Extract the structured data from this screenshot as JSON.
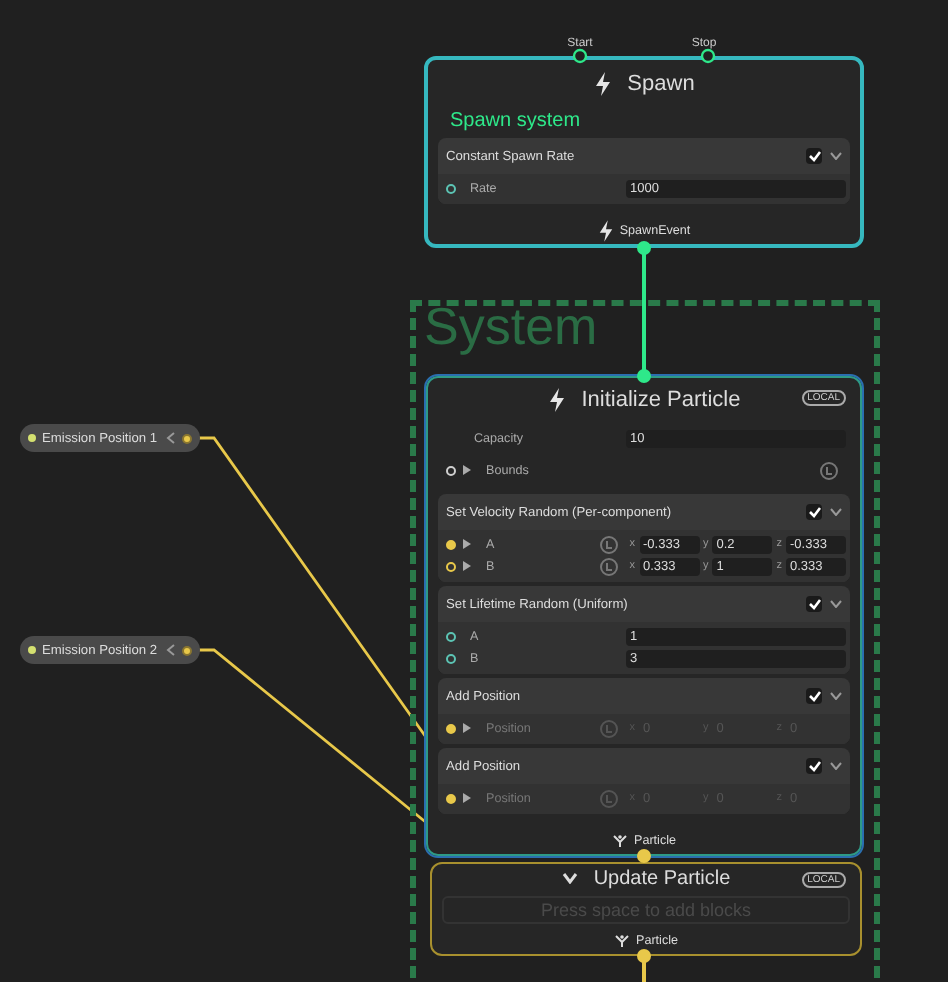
{
  "system": {
    "title": "System"
  },
  "parameters": [
    {
      "label": "Emission Position 1"
    },
    {
      "label": "Emission Position 2"
    }
  ],
  "contexts": [
    {
      "kind": "spawn",
      "title": "Spawn",
      "inputs": [
        "Start",
        "Stop"
      ],
      "subtitle": "Spawn system",
      "blocks": [
        {
          "title": "Constant Spawn Rate",
          "enabled": true,
          "rows": [
            {
              "kind": "field",
              "label": "Rate",
              "value": "1000",
              "port": {
                "color": "#5cc4b4",
                "connected": false
              }
            }
          ]
        }
      ],
      "output": "SpawnEvent"
    },
    {
      "kind": "initialize",
      "title": "Initialize Particle",
      "badge": "LOCAL",
      "rows": [
        {
          "kind": "field",
          "label": "Capacity",
          "value": "10"
        },
        {
          "kind": "space",
          "label": "Bounds",
          "expandable": true,
          "port": {
            "color": "#cfcfcf",
            "connected": false
          }
        }
      ],
      "blocks": [
        {
          "title": "Set Velocity Random (Per-component)",
          "enabled": true,
          "rows": [
            {
              "kind": "vector",
              "label": "A",
              "expandable": true,
              "port": {
                "color": "#e8c84a",
                "connected": true
              },
              "components": [
                {
                  "axis": "x",
                  "value": "-0.333"
                },
                {
                  "axis": "y",
                  "value": "0.2"
                },
                {
                  "axis": "z",
                  "value": "-0.333"
                }
              ]
            },
            {
              "kind": "vector",
              "label": "B",
              "expandable": true,
              "port": {
                "color": "#e8c84a",
                "connected": false
              },
              "components": [
                {
                  "axis": "x",
                  "value": "0.333"
                },
                {
                  "axis": "y",
                  "value": "1"
                },
                {
                  "axis": "z",
                  "value": "0.333"
                }
              ]
            }
          ]
        },
        {
          "title": "Set Lifetime Random (Uniform)",
          "enabled": true,
          "rows": [
            {
              "kind": "field",
              "label": "A",
              "value": "1",
              "port": {
                "color": "#5cc4b4",
                "connected": false
              }
            },
            {
              "kind": "field",
              "label": "B",
              "value": "3",
              "port": {
                "color": "#5cc4b4",
                "connected": false
              }
            }
          ]
        },
        {
          "title": "Add Position",
          "enabled": true,
          "rows": [
            {
              "kind": "vector",
              "label": "Position",
              "expandable": true,
              "disabled": true,
              "port": {
                "color": "#e8c84a",
                "connected": true
              },
              "components": [
                {
                  "axis": "x",
                  "value": "0"
                },
                {
                  "axis": "y",
                  "value": "0"
                },
                {
                  "axis": "z",
                  "value": "0"
                }
              ]
            }
          ]
        },
        {
          "title": "Add Position",
          "enabled": true,
          "rows": [
            {
              "kind": "vector",
              "label": "Position",
              "expandable": true,
              "disabled": true,
              "port": {
                "color": "#e8c84a",
                "connected": true
              },
              "components": [
                {
                  "axis": "x",
                  "value": "0"
                },
                {
                  "axis": "y",
                  "value": "0"
                },
                {
                  "axis": "z",
                  "value": "0"
                }
              ]
            }
          ]
        }
      ],
      "output": "Particle"
    },
    {
      "kind": "update",
      "title": "Update Particle",
      "badge": "LOCAL",
      "placeholder": "Press space to add blocks",
      "output": "Particle"
    }
  ]
}
